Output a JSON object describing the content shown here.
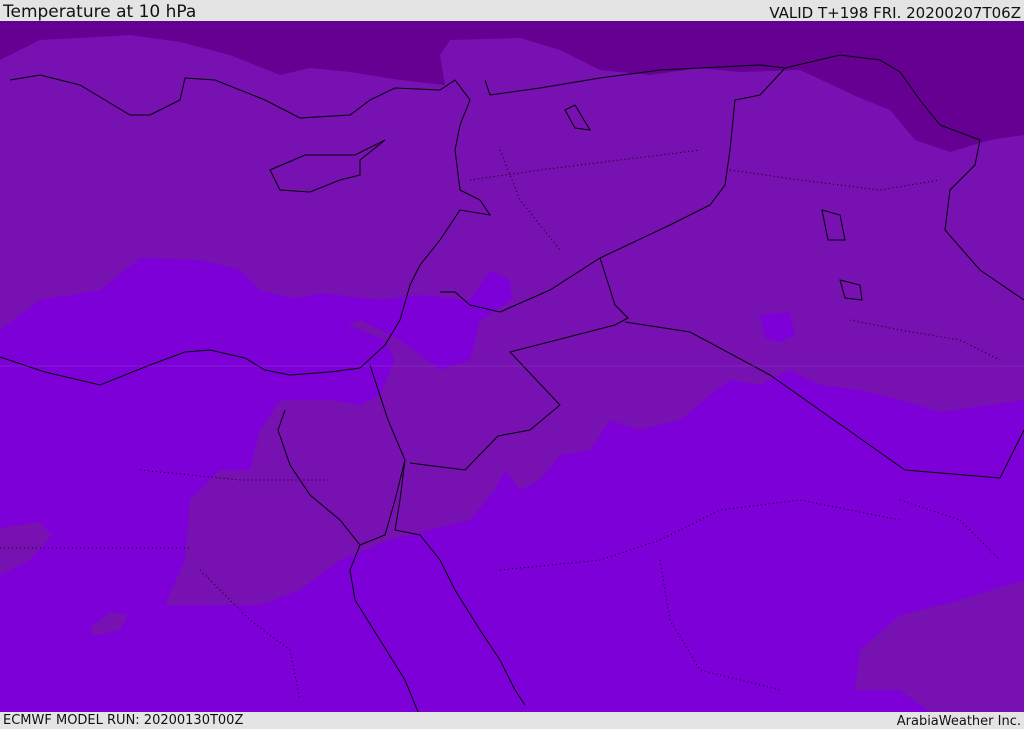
{
  "header": {
    "title": "Temperature at 10 hPa",
    "valid": "VALID T+198 FRI. 20200207T06Z"
  },
  "footer": {
    "model_run": "ECMWF MODEL RUN: 20200130T00Z",
    "credit": "ArabiaWeather Inc."
  },
  "colors": {
    "warm_band": "#7d00d9",
    "mid_band": "#7811b2",
    "cold_band": "#650093",
    "coastline": "#000000",
    "header_bg": "#e4e4e4"
  }
}
